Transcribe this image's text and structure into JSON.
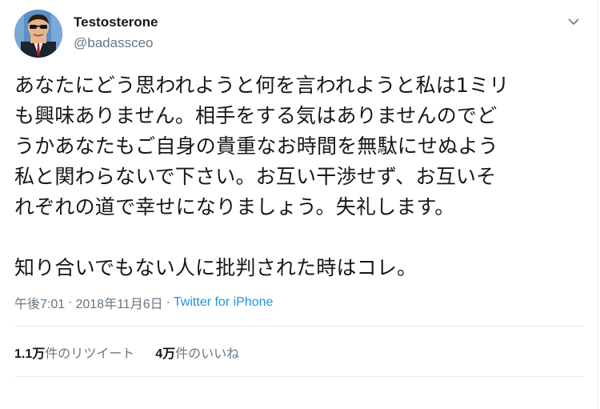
{
  "user": {
    "name": "Testosterone",
    "handle": "@badassceo"
  },
  "tweet": {
    "text": "あなたにどう思われようと何を言われようと私は1ミリ\nも興味ありません。相手をする気はありませんのでど\nうかあなたもご自身の貴重なお時間を無駄にせぬよう\n私と関わらないで下さい。お互い干渉せず、お互いそ\nれぞれの道で幸せになりましょう。失礼します。\n\n知り合いでもない人に批判された時はコレ。",
    "time": "午後7:01",
    "date": "2018年11月6日",
    "separator": "·",
    "source": "Twitter for iPhone"
  },
  "stats": {
    "retweets_count": "1.1万",
    "retweets_label": "件のリツイート",
    "likes_count": "4万",
    "likes_label": "件のいいね"
  },
  "colors": {
    "text": "#14171a",
    "secondary": "#657786",
    "link": "#1b95e0",
    "divider": "#e6ecf0"
  },
  "icons": {
    "menu": "chevron-down-icon",
    "avatar": "avatar"
  }
}
